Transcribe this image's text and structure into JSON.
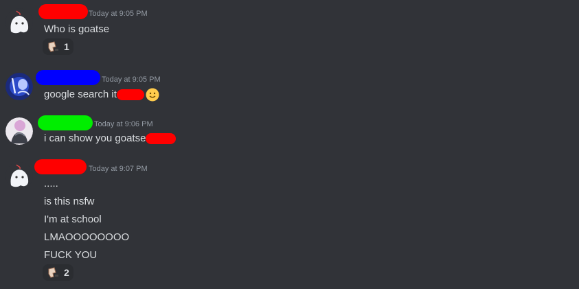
{
  "messages": [
    {
      "timestamp": "Today at 9:05 PM",
      "lines": [
        "Who is goatse"
      ],
      "reaction": {
        "icon": "hand-emoji-icon",
        "count": "1"
      }
    },
    {
      "timestamp": "Today at 9:05 PM",
      "lines": [
        "google search it"
      ],
      "emoji": "slightly-smiling-face-icon"
    },
    {
      "timestamp": "Today at 9:06 PM",
      "lines": [
        "i can show you goatse"
      ]
    },
    {
      "timestamp": "Today at 9:07 PM",
      "lines": [
        ".....",
        "is this nsfw",
        "I'm at school",
        "LMAOOOOOOOO",
        "FUCK YOU"
      ],
      "reaction": {
        "icon": "hand-emoji-icon",
        "count": "2"
      }
    }
  ],
  "colors": {
    "background": "#313338",
    "text": "#dbdee1",
    "timestamp": "#949ba4",
    "redaction_red": "#ff0000",
    "redaction_blue": "#0000ff",
    "redaction_green": "#00ee00"
  }
}
